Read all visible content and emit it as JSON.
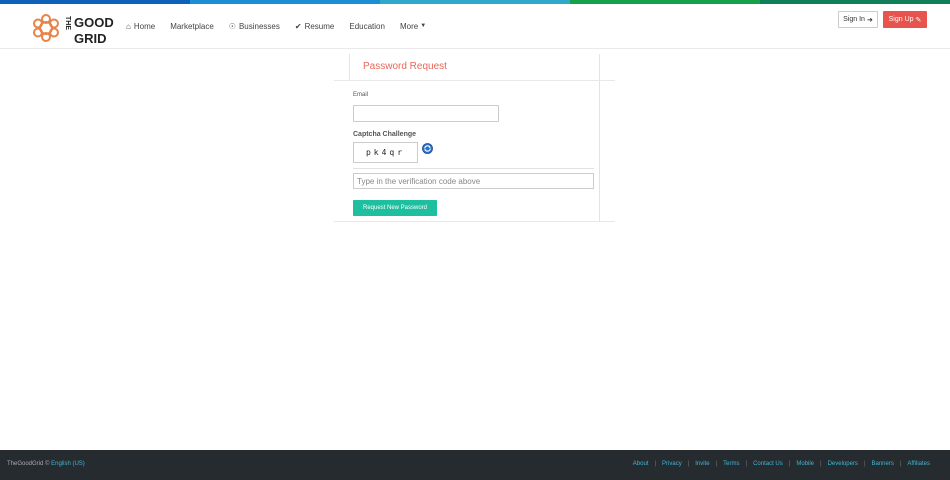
{
  "colors": {
    "stripe": [
      "#0d62b8",
      "#1a8fd6",
      "#2fa8c9",
      "#16a04a",
      "#0f7f5a"
    ],
    "accent_red": "#e8534d",
    "accent_teal": "#1dbf9e",
    "title_orange": "#e8675b",
    "footer_bg": "#262b2f",
    "link_blue": "#3fb7d6"
  },
  "logo": {
    "line1": "THE",
    "line2": "GOOD",
    "line3": "GRID",
    "color": "#e8834a"
  },
  "nav": {
    "items": [
      {
        "label": "Home",
        "icon": "home-icon"
      },
      {
        "label": "Marketplace",
        "icon": ""
      },
      {
        "label": "Businesses",
        "icon": "globe-icon"
      },
      {
        "label": "Resume",
        "icon": "check-icon"
      },
      {
        "label": "Education",
        "icon": ""
      },
      {
        "label": "More",
        "icon": "caret-down-icon"
      }
    ]
  },
  "header": {
    "signin_label": "Sign In",
    "signup_label": "Sign Up"
  },
  "form": {
    "title": "Password Request",
    "email_label": "Email",
    "email_value": "",
    "captcha_label": "Captcha Challenge",
    "captcha_text": "pk4qr",
    "verify_placeholder": "Type in the verification code above",
    "submit_label": "Request New Password"
  },
  "footer": {
    "brand": "TheGoodGrid ©",
    "language": "English (US)",
    "links": [
      "About",
      "Privacy",
      "Invite",
      "Terms",
      "Contact Us",
      "Mobile",
      "Developers",
      "Banners",
      "Affiliates"
    ]
  }
}
